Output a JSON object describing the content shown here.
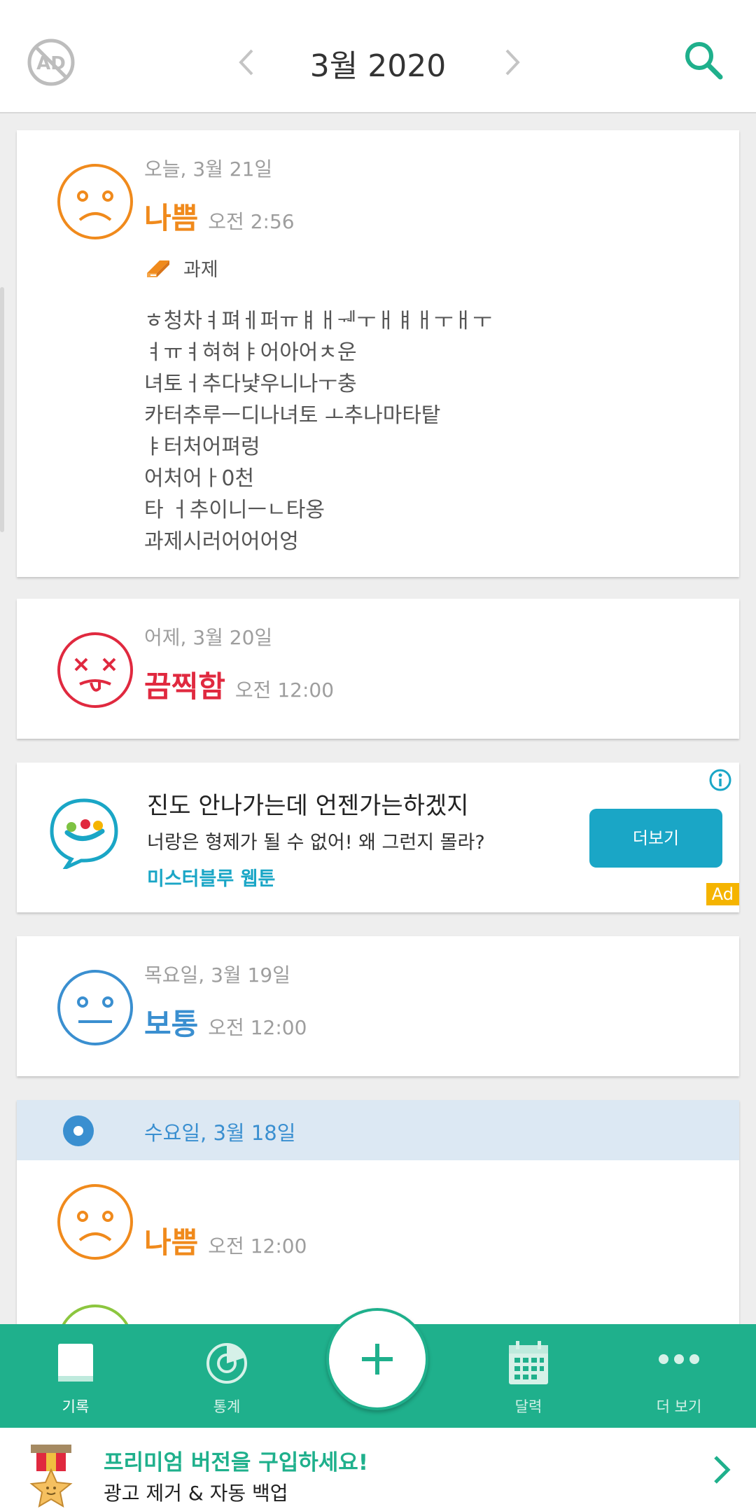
{
  "header": {
    "month_title": "3월 2020"
  },
  "entries": [
    {
      "date": "오늘, 3월 21일",
      "mood": "나쁨",
      "time": "오전 2:56",
      "mood_color": "#f08a1c",
      "tag": "과제",
      "note_lines": [
        "ㅎ청차ㅕ펴ㅔ퍼ㅠㅒㅐᅰㅜㅐㅒㅐㅜㅐㅜ",
        "ㅕㅠㅕ혀혀ㅑ어아어ㅊ운",
        "녀토ㅓ추다냧우니나ㅜ충",
        "카터추루ㅡ디나녀토 ㅗ추나마타탙",
        "ㅑ터처어펴렁",
        "어처어ㅏ0천",
        "타 ㅓ추이니ㅡㄴ타옹",
        "과제시러어어어엉"
      ]
    },
    {
      "date": "어제, 3월 20일",
      "mood": "끔찍함",
      "time": "오전 12:00",
      "mood_color": "#e0293f"
    },
    {
      "date": "목요일, 3월 19일",
      "mood": "보통",
      "time": "오전 12:00",
      "mood_color": "#3a8fd0"
    }
  ],
  "ad": {
    "headline": "진도 안나가는데 언젠가는하겠지",
    "body": "너랑은 형제가 될 수 없어! 왜 그런지 몰라?",
    "brand": "미스터블루 웹툰",
    "button": "더보기",
    "badge": "Ad"
  },
  "day_group": {
    "label": "수요일, 3월 18일",
    "entry": {
      "mood": "나쁨",
      "time": "오전 12:00",
      "mood_color": "#f08a1c"
    }
  },
  "nav": {
    "items": [
      {
        "label": "기록",
        "icon": "book-icon"
      },
      {
        "label": "통계",
        "icon": "chart-icon"
      },
      {
        "label": "달력",
        "icon": "calendar-icon"
      },
      {
        "label": "더 보기",
        "icon": "more-icon"
      }
    ],
    "fab_icon": "plus-icon",
    "accent": "#1fb08c"
  },
  "premium": {
    "title": "프리미엄 버전을 구입하세요!",
    "subtitle": "광고 제거 & 자동 백업"
  }
}
